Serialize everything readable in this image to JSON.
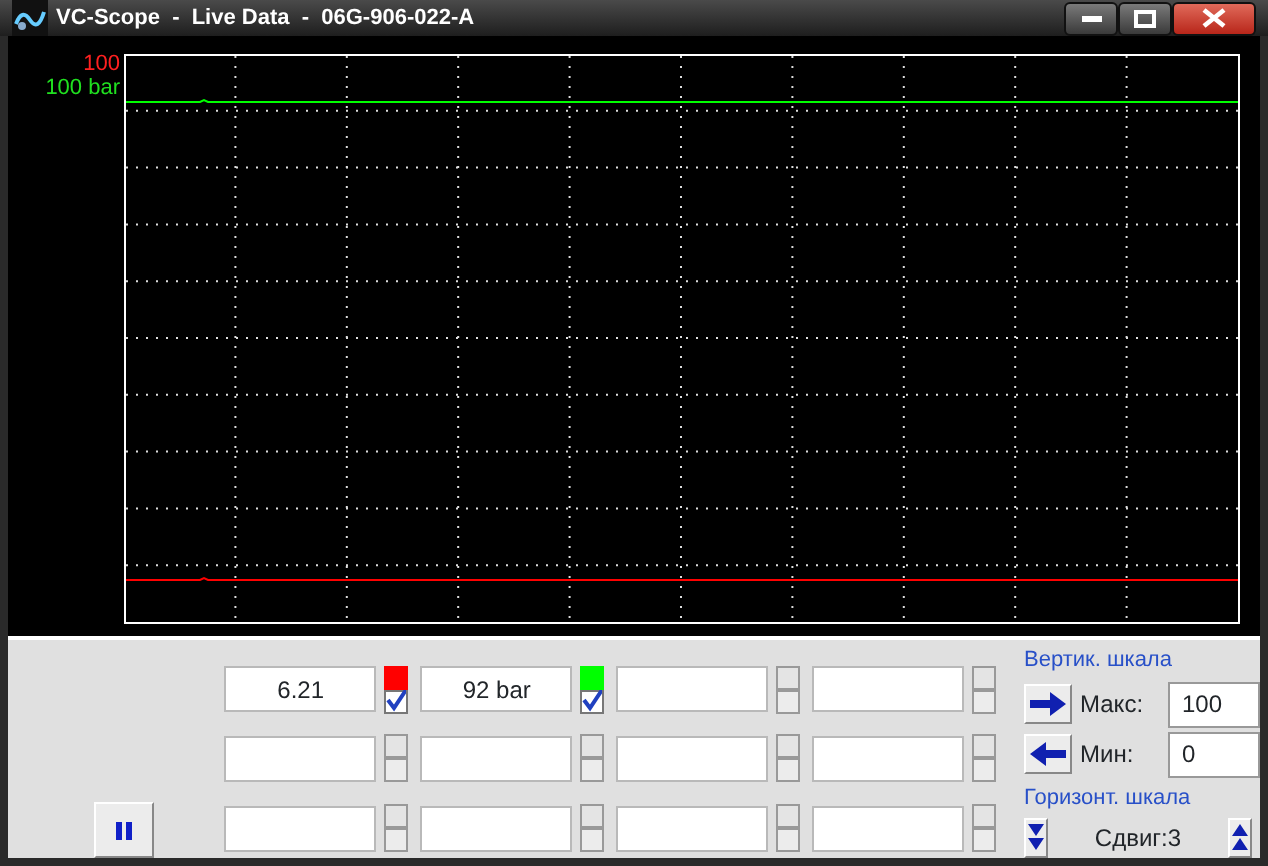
{
  "window": {
    "title": "VC-Scope  -  Live Data  -  06G-906-022-A"
  },
  "scale_labels": [
    {
      "text": "100",
      "color": "#ff2020"
    },
    {
      "text": "100 bar",
      "color": "#20e020"
    }
  ],
  "channels": [
    {
      "value": "6.21",
      "color": "#ff0000",
      "checked": true
    },
    {
      "value": "92 bar",
      "color": "#00ff00",
      "checked": true
    },
    {
      "checked": false
    },
    {
      "checked": false
    },
    {
      "checked": false
    },
    {
      "checked": false
    },
    {
      "checked": false
    },
    {
      "checked": false
    },
    {
      "checked": false
    },
    {
      "checked": false
    },
    {
      "checked": false
    },
    {
      "checked": false
    }
  ],
  "vertical_scale": {
    "heading": "Вертик. шкала",
    "max_label": "Макс:",
    "max_value": "100",
    "min_label": "Мин:",
    "min_value": "0"
  },
  "horizontal_scale": {
    "heading": "Горизонт. шкала",
    "shift": "Сдвиг:3"
  }
}
